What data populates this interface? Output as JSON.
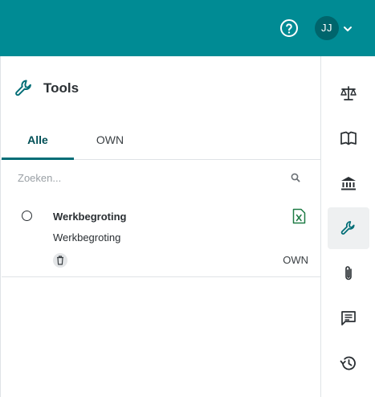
{
  "header": {
    "avatar_initials": "JJ",
    "help_icon": "help-circle-icon",
    "avatar_menu_icon": "chevron-down-icon"
  },
  "panel": {
    "title": "Tools",
    "title_icon": "wrench-icon",
    "tabs": [
      {
        "label": "Alle",
        "active": true
      },
      {
        "label": "OWN",
        "active": false
      }
    ],
    "search": {
      "placeholder": "Zoeken...",
      "value": ""
    },
    "items": [
      {
        "title": "Werkbegroting",
        "subtitle": "Werkbegroting",
        "owner": "OWN",
        "file_icon": "excel-file-icon",
        "action_icon": "trash-icon"
      }
    ]
  },
  "rail": {
    "items": [
      {
        "icon": "scale-icon",
        "active": false
      },
      {
        "icon": "book-icon",
        "active": false
      },
      {
        "icon": "bank-icon",
        "active": false
      },
      {
        "icon": "wrench-icon",
        "active": true
      },
      {
        "icon": "paperclip-icon",
        "active": false
      },
      {
        "icon": "comment-icon",
        "active": false
      },
      {
        "icon": "history-icon",
        "active": false
      }
    ]
  },
  "colors": {
    "header_bg": "#008b94",
    "accent": "#006d76",
    "excel_green": "#1e7b45"
  }
}
